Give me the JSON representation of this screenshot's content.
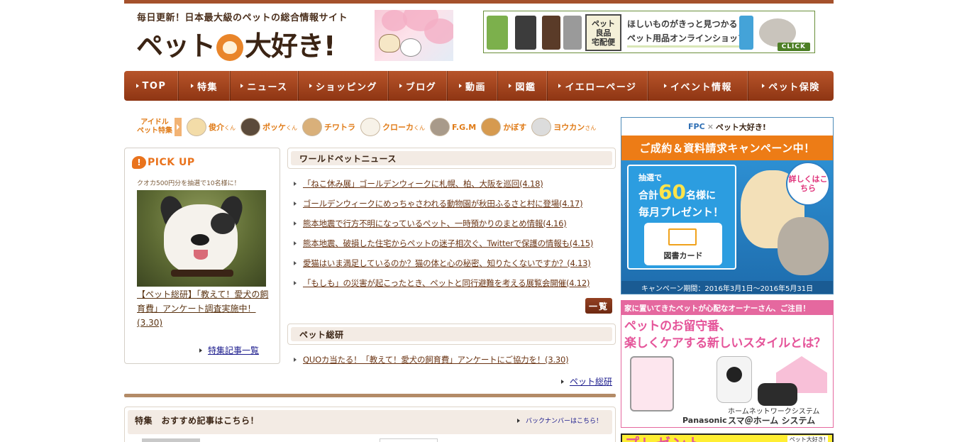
{
  "header": {
    "tagline": "毎日更新！日本最大級のペットの総合情報サイト",
    "logo_before": "ペット",
    "logo_after": "大好き!",
    "shop_banner": {
      "badge_lines": [
        "ペット",
        "良品",
        "宅配便"
      ],
      "line1": "ほしいものがきっと見つかる",
      "line2": "ペット用品オンラインショップ",
      "click": "CLICK"
    }
  },
  "nav": {
    "items": [
      {
        "label": "TOP"
      },
      {
        "label": "特集"
      },
      {
        "label": "ニュース"
      },
      {
        "label": "ショッピング"
      },
      {
        "label": "ブログ"
      },
      {
        "label": "動画"
      },
      {
        "label": "図鑑"
      },
      {
        "label": "イエローページ"
      },
      {
        "label": "イベント情報"
      },
      {
        "label": "ペット保険"
      }
    ]
  },
  "idol": {
    "label_line1": "アイドル",
    "label_line2": "ペット特集",
    "pets": [
      {
        "name": "俊介",
        "suffix": "くん",
        "color": "#f3dca8"
      },
      {
        "name": "ポッケ",
        "suffix": "くん",
        "color": "#5b4a3a"
      },
      {
        "name": "チワトラ",
        "suffix": "",
        "color": "#d9b07a"
      },
      {
        "name": "クローカ",
        "suffix": "くん",
        "color": "#f7f2e8"
      },
      {
        "name": "F.G.M",
        "suffix": "",
        "color": "#a89a8a"
      },
      {
        "name": "かぼす",
        "suffix": "",
        "color": "#d69a4f"
      },
      {
        "name": "ヨウカン",
        "suffix": "さん",
        "color": "#dcdcdc"
      }
    ]
  },
  "pickup": {
    "title": "PICK UP",
    "subtitle": "クオカ500円分を抽選で10名様に！",
    "caption": "【ペット総研】「教えて！愛犬の飼育費」アンケート調査実施中！(3.30)",
    "more": "特集記事一覧"
  },
  "world_news": {
    "title": "ワールドペットニュース",
    "items": [
      "「ねこ休み展」ゴールデンウィークに札幌、柏、大阪を巡回(4.18)",
      "ゴールデンウィークにめっちゃさわれる動物園が秋田ふるさと村に登場(4.17)",
      "熊本地震で行方不明になっているペット、一時預かりのまとめ情報(4.16)",
      "熊本地震、破損した住宅からペットの迷子相次ぐ、Twitterで保護の情報も(4.15)",
      "愛猫はいま満足しているのか？猫の体と心の秘密、知りたくないですか？(4.13)",
      "「もしも」の災害が起こったとき、ペットと同行避難を考える展覧会開催(4.12)"
    ],
    "list_button": "一覧"
  },
  "pet_souken": {
    "title": "ペット総研",
    "items": [
      "QUOカ当たる！「教えて！愛犬の飼育費」アンケートにご協力を！(3.30)"
    ],
    "link": "ペット総研"
  },
  "feature": {
    "title": "特集　おすすめ記事はこちら！",
    "backnumber": "バックナンバーはこちら！"
  },
  "campaign": {
    "top_fpc": "FPC",
    "top_x": "×",
    "top_site": "ペット大好き!",
    "headline": "ご成約＆資料請求キャンペーン中！",
    "lottery": "抽選で",
    "total": "合計",
    "count": "60",
    "count_suffix": "名様に",
    "monthly": "毎月プレゼント！",
    "gift": "図書カード",
    "detail": "詳しくはこちら",
    "period": "キャンペーン期間：2016年3月1日～2016年5月31日"
  },
  "panasonic": {
    "bar": "家に置いてきたペットが心配なオーナーさん、ご注目！",
    "headline1": "ペットのお留守番、",
    "headline2": "楽しくケアする新しいスタイルとは？",
    "brand": "Panasonic",
    "system_line1": "ホームネットワークシステム",
    "system_line2": "スマ＠ホーム システム"
  },
  "yellow_ad": {
    "text": "プレゼント",
    "small": "ペット大好き!"
  },
  "colors": {
    "nav_brown": "#a5512c",
    "accent_orange": "#e9731d",
    "link_brown": "#6b3514",
    "campaign_blue": "#2d8fd2",
    "panasonic_pink": "#e5689f"
  }
}
